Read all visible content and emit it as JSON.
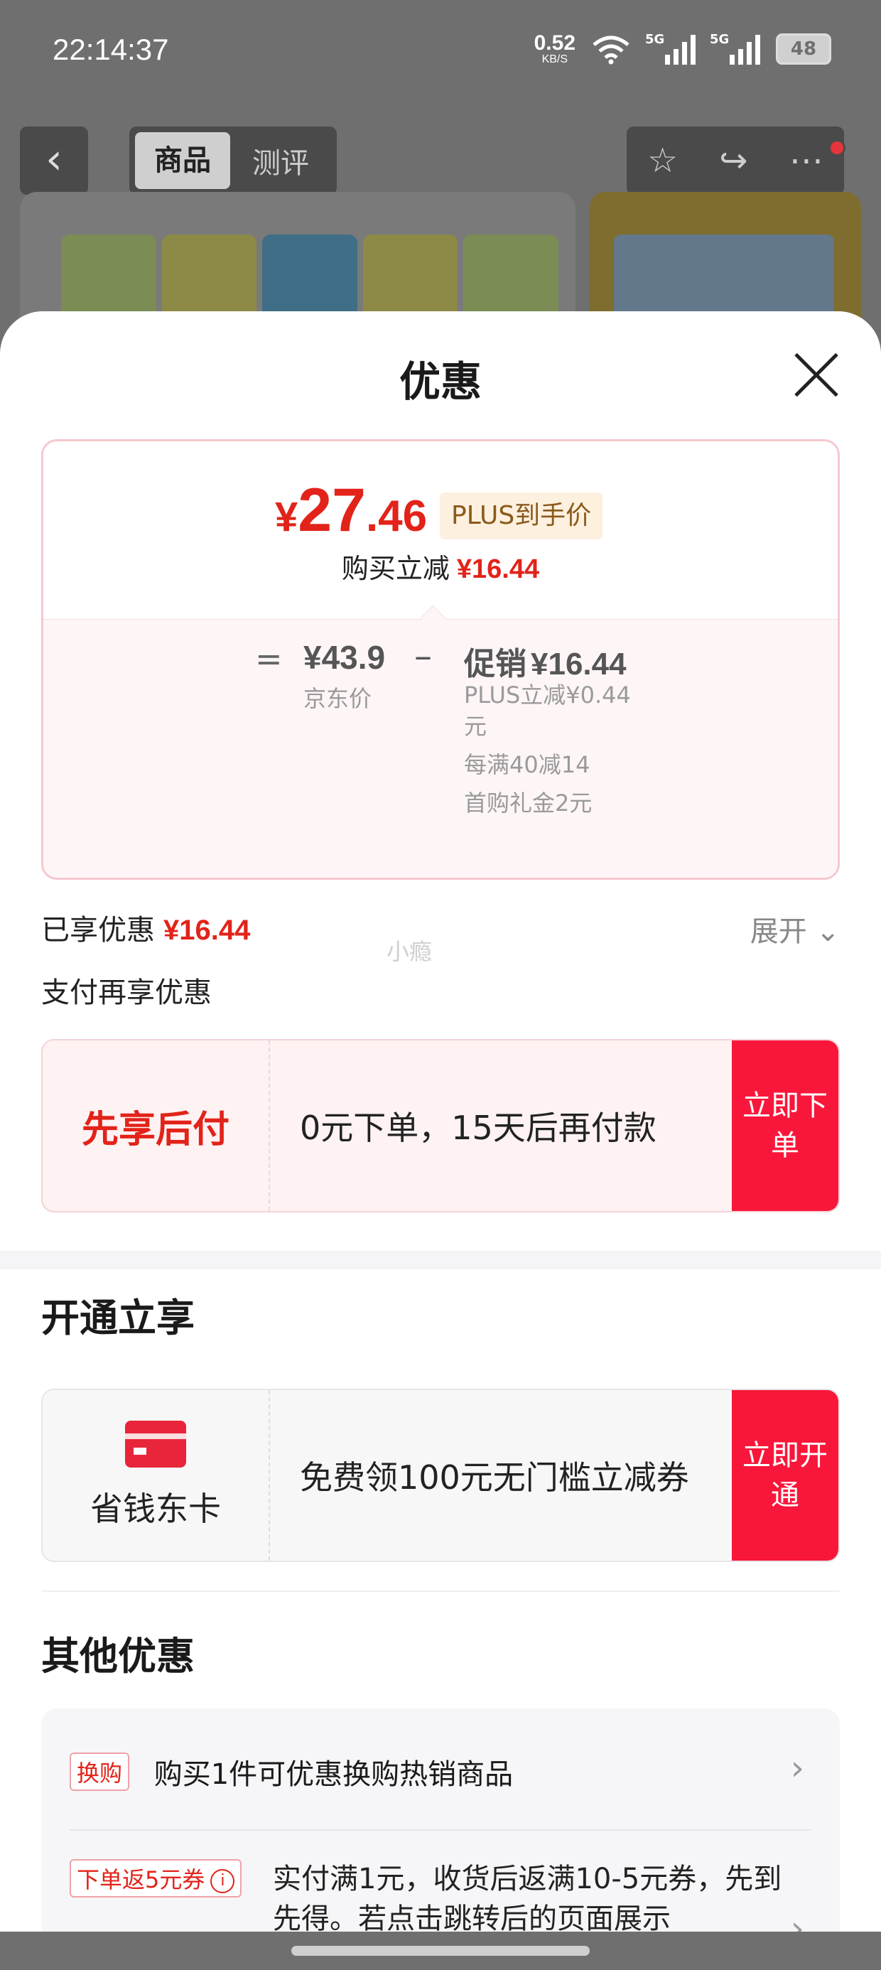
{
  "status_bar": {
    "time": "22:14:37",
    "net_speed": "0.52",
    "net_unit": "KB/S",
    "signal1": "5G",
    "signal2": "5G",
    "battery": "48"
  },
  "background_nav": {
    "tab_active": "商品",
    "tab_inactive": "测评",
    "back_icon": "back-arrow-icon",
    "actions": [
      "star-icon",
      "share-icon",
      "more-icon"
    ]
  },
  "sheet": {
    "title": "优惠",
    "close_icon": "close-icon"
  },
  "price_card": {
    "currency": "¥",
    "price_int": "27",
    "price_dec": ".46",
    "plus_tag": "PLUS到手价",
    "instant_label": "购买立减",
    "instant_value": "¥16.44",
    "equals": "=",
    "jd_price": "¥43.9",
    "jd_label": "京东价",
    "minus": "–",
    "promo_label": "促销",
    "promo_value": "¥16.44",
    "details": [
      "PLUS立减¥0.44元",
      "每满40减14",
      "首购礼金2元"
    ]
  },
  "enjoyed": {
    "label": "已享优惠",
    "value": "¥16.44",
    "expand": "展开"
  },
  "watermark": "小瘾",
  "pay_more_label": "支付再享优惠",
  "pay_later": {
    "badge": "先享后付",
    "text": "0元下单，15天后再付款",
    "cta": "立即下单"
  },
  "open_section": {
    "title": "开通立享",
    "card_name": "省钱东卡",
    "card_icon": "card-icon",
    "text": "免费领100元无门槛立减券",
    "cta": "立即开通"
  },
  "other_section": {
    "title": "其他优惠",
    "items": [
      {
        "tag": "换购",
        "text": "购买1件可优惠换购热销商品"
      },
      {
        "tag": "下单返5元券",
        "text": "实付满1元，收货后返满10-5元券，先到先得。若点击跳转后的页面展示"
      }
    ]
  },
  "colors": {
    "accent_red": "#e2231a",
    "cta_red": "#f8173a",
    "plus_bg": "#fdf0de"
  }
}
